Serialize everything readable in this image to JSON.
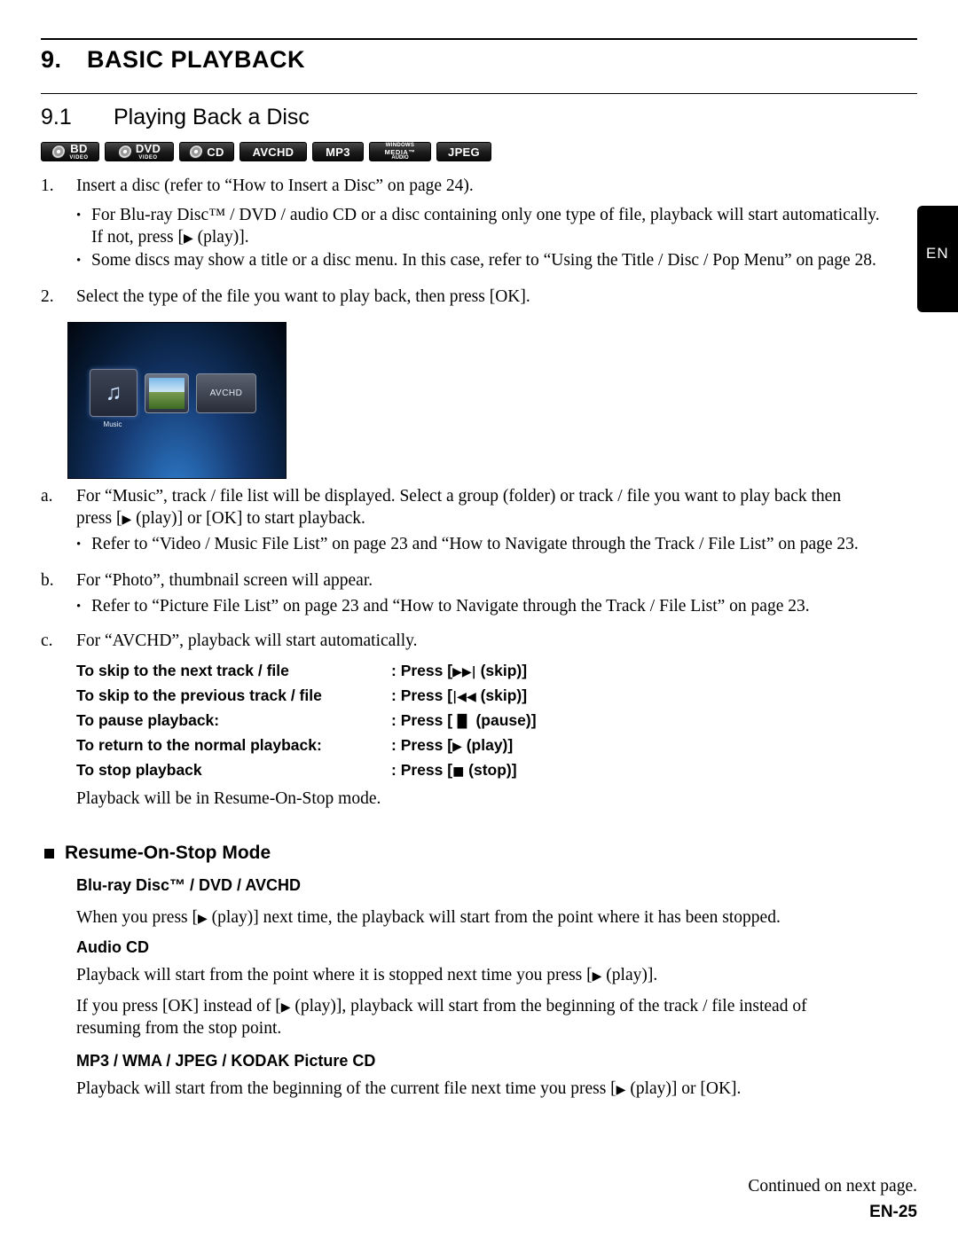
{
  "chapter": {
    "number": "9.",
    "title": "BASIC PLAYBACK"
  },
  "section": {
    "number": "9.1",
    "title": "Playing Back a Disc"
  },
  "badges": [
    {
      "name": "bd-video",
      "line1": "BD",
      "line2": "VIDEO",
      "disc": true
    },
    {
      "name": "dvd-video",
      "line1": "DVD",
      "line2": "VIDEO",
      "disc": true
    },
    {
      "name": "cd",
      "line1": "CD",
      "line2": "",
      "disc": true
    },
    {
      "name": "avchd",
      "line1": "AVCHD",
      "line2": "",
      "disc": false
    },
    {
      "name": "mp3",
      "line1": "MP3",
      "line2": "",
      "disc": false
    },
    {
      "name": "windows-media-audio",
      "line1": "WINDOWS",
      "line2": "MEDIA™",
      "line3": "AUDIO",
      "disc": false
    },
    {
      "name": "jpeg",
      "line1": "JPEG",
      "line2": "",
      "disc": false
    }
  ],
  "steps": {
    "step1_num": "1.",
    "step1_text": "Insert a disc (refer to “How to Insert a Disc” on page 24).",
    "step1_b1": "For Blu-ray Disc™ / DVD / audio CD or a disc containing only one type of file, playback will start automatically.",
    "step1_b1_line2_a": "If not, press [",
    "step1_b1_line2_b": " (play)].",
    "step1_b2": "Some discs may show a title or a disc menu. In this case, refer to “Using the Title / Disc / Pop Menu” on page 28.",
    "step2_num": "2.",
    "step2_text": "Select the type of the file you want to play back, then press [OK]."
  },
  "screenshot": {
    "music_label": "Music",
    "avchd_label": "AVCHD",
    "note_glyph": "♫"
  },
  "notes": {
    "a_num": "a.",
    "a_line1": "For “Music”, track / file list will be displayed. Select a group (folder) or track / file you want to play back then",
    "a_line2_a": "press [",
    "a_line2_b": " (play)] or [OK] to start playback.",
    "a_bullet": "Refer to “Video / Music File List” on page 23 and “How to Navigate through the Track / File List” on page 23.",
    "b_num": "b.",
    "b_line1": "For “Photo”, thumbnail screen will appear.",
    "b_bullet": "Refer to “Picture File List” on page 23 and “How to Navigate through the Track / File List” on page 23.",
    "c_num": "c.",
    "c_line1": "For “AVCHD”, playback will start automatically."
  },
  "operations": [
    {
      "label": "To skip to the next track / file",
      "action_prefix": ": Press [",
      "glyph": "▶▶|",
      "action_suffix": " (skip)]"
    },
    {
      "label": "To skip to the previous track / file",
      "action_prefix": ": Press [",
      "glyph": "|◀◀",
      "action_suffix": " (skip)]"
    },
    {
      "label": "To pause playback:",
      "action_prefix": ": Press [",
      "glyph": "▐▌",
      "action_suffix": " (pause)]"
    },
    {
      "label": "To return to the normal playback:",
      "action_prefix": ": Press [",
      "glyph": "▶",
      "action_suffix": " (play)]"
    },
    {
      "label": "To stop playback",
      "action_prefix": ": Press [",
      "glyph": "■",
      "action_suffix": " (stop)]"
    }
  ],
  "resume_note": "Playback will be in Resume-On-Stop mode.",
  "resume": {
    "heading": "Resume-On-Stop Mode",
    "sub1": "Blu-ray Disc™ / DVD / AVCHD",
    "sub1_text_a": "When you press [",
    "sub1_text_b": " (play)] next time, the playback will start from the point where it has been stopped.",
    "sub2": "Audio CD",
    "sub2_text_a": "Playback will start from the point where it is stopped next time you press [",
    "sub2_text_b": " (play)].",
    "sub2_p2_a": "If you press [OK] instead of [",
    "sub2_p2_b": " (play)], playback will start from the beginning of the track / file instead of",
    "sub2_p2_line2": "resuming from the stop point.",
    "sub3": "MP3 / WMA / JPEG / KODAK Picture CD",
    "sub3_text_a": "Playback will start from the beginning of the current file next time you press [",
    "sub3_text_b": " (play)] or [OK]."
  },
  "side_tab": "EN",
  "footer": {
    "continued": "Continued on next page.",
    "page": "EN-25"
  },
  "glyphs": {
    "play": "▶"
  }
}
